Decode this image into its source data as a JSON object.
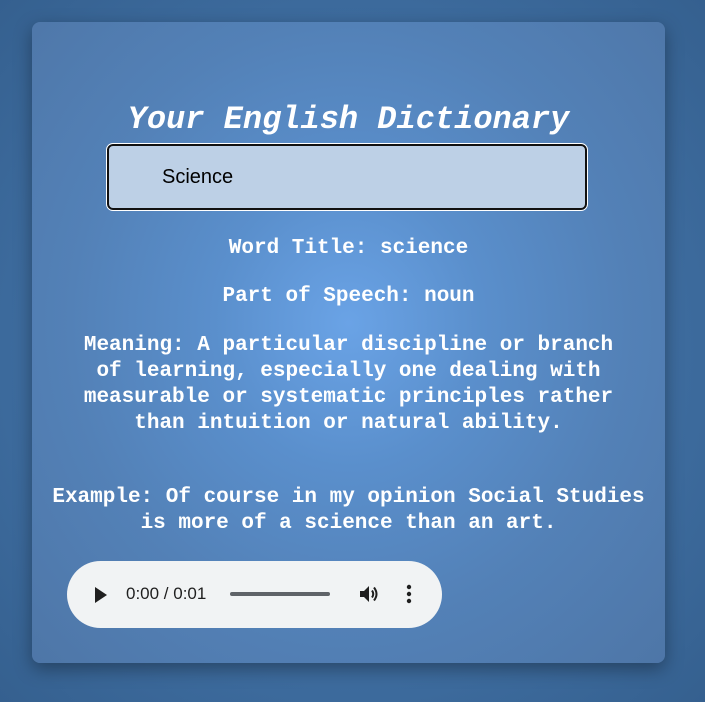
{
  "header": {
    "title": "Your English Dictionary"
  },
  "search": {
    "value": "Science"
  },
  "result": {
    "word_title": "Word Title: science",
    "part_of_speech": "Part of Speech: noun",
    "meaning": "Meaning: A particular discipline or branch of learning, especially one dealing with measurable or systematic principles rather than intuition or natural ability.",
    "example": "Example: Of course in my opinion Social Studies is more of a science than an art."
  },
  "audio": {
    "time": "0:00 / 0:01",
    "progress": 0,
    "icons": [
      "play-icon",
      "volume-icon",
      "more-vert-icon"
    ]
  },
  "colors": {
    "background": "#3c6a9c",
    "card": "#5a8fcc",
    "text": "#ffffff",
    "input_background": "#bdd0e6",
    "audio_background": "#f1f3f4"
  }
}
